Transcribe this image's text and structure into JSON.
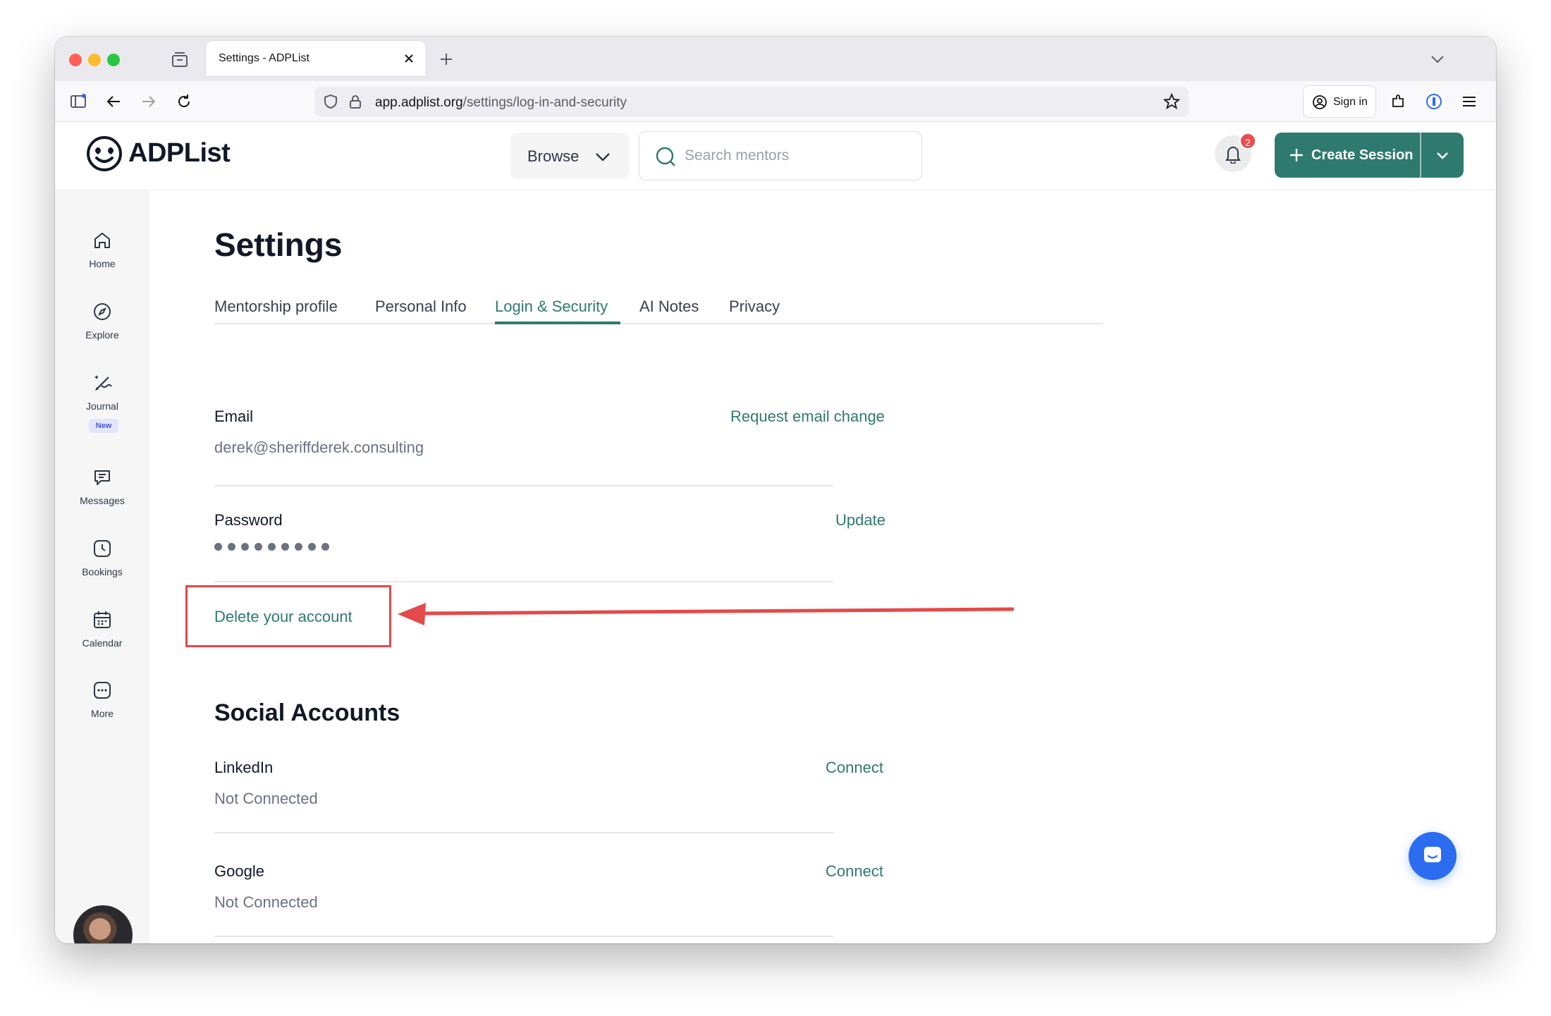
{
  "browser": {
    "tab_title": "Settings - ADPList",
    "url_domain": "app.adplist.org",
    "url_path": "/settings/log-in-and-security",
    "sign_in_label": "Sign in"
  },
  "header": {
    "logo_text": "ADPList",
    "browse_label": "Browse",
    "search_placeholder": "Search mentors",
    "notification_count": "2",
    "create_session_label": "Create Session"
  },
  "sidebar": {
    "items": [
      {
        "label": "Home",
        "icon": "home-icon"
      },
      {
        "label": "Explore",
        "icon": "compass-icon"
      },
      {
        "label": "Journal",
        "icon": "pen-sparkle-icon",
        "badge": "New"
      },
      {
        "label": "Messages",
        "icon": "chat-icon"
      },
      {
        "label": "Bookings",
        "icon": "clock-icon"
      },
      {
        "label": "Calendar",
        "icon": "calendar-icon"
      },
      {
        "label": "More",
        "icon": "more-icon"
      }
    ]
  },
  "main": {
    "title": "Settings",
    "tabs": [
      {
        "label": "Mentorship profile"
      },
      {
        "label": "Personal Info"
      },
      {
        "label": "Login & Security",
        "active": true
      },
      {
        "label": "AI Notes"
      },
      {
        "label": "Privacy"
      }
    ],
    "email": {
      "label": "Email",
      "value": "derek@sheriffderek.consulting",
      "action": "Request email change"
    },
    "password": {
      "label": "Password",
      "action": "Update"
    },
    "delete_account": "Delete your account",
    "social": {
      "title": "Social Accounts",
      "accounts": [
        {
          "label": "LinkedIn",
          "status": "Not Connected",
          "action": "Connect"
        },
        {
          "label": "Google",
          "status": "Not Connected",
          "action": "Connect"
        }
      ]
    }
  },
  "colors": {
    "accent": "#2f7a6f",
    "annotation": "#e34a4a",
    "badge": "#e94d4d",
    "chat": "#2b6cf0"
  }
}
